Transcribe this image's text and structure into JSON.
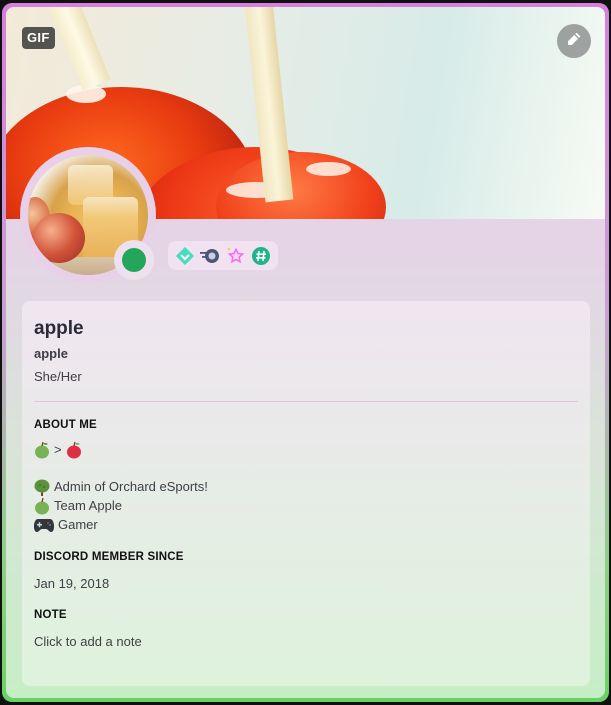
{
  "profile": {
    "banner": {
      "badge": "GIF",
      "edit_icon": "pencil-icon"
    },
    "avatar": {
      "status": "online",
      "status_color": "#23a55a"
    },
    "badges": [
      {
        "icon": "hypesquad-balance-badge-icon",
        "label": "HypeSquad Balance"
      },
      {
        "icon": "active-developer-speed-badge-icon",
        "label": "Nitro Boost"
      },
      {
        "icon": "quest-star-badge-icon",
        "label": "Completed a Quest"
      },
      {
        "icon": "hashtag-badge-icon",
        "label": "Originally known as"
      }
    ],
    "display_name": "apple",
    "username": "apple",
    "pronouns": "She/Her",
    "about_me": {
      "title": "ABOUT ME",
      "lines": [
        {
          "emoji": "green-apple",
          "text": ">",
          "emoji2": "red-apple"
        },
        {
          "emoji": "tree",
          "text": "Admin of Orchard eSports!"
        },
        {
          "emoji": "green-apple",
          "text": "Team Apple"
        },
        {
          "emoji": "game-controller",
          "text": "Gamer"
        }
      ]
    },
    "member_since": {
      "title": "DISCORD MEMBER SINCE",
      "date": "Jan 19, 2018"
    },
    "note": {
      "title": "NOTE",
      "placeholder": "Click to add a note"
    },
    "theme": {
      "primary": "#d67fdc",
      "accent": "#6bd163"
    }
  }
}
